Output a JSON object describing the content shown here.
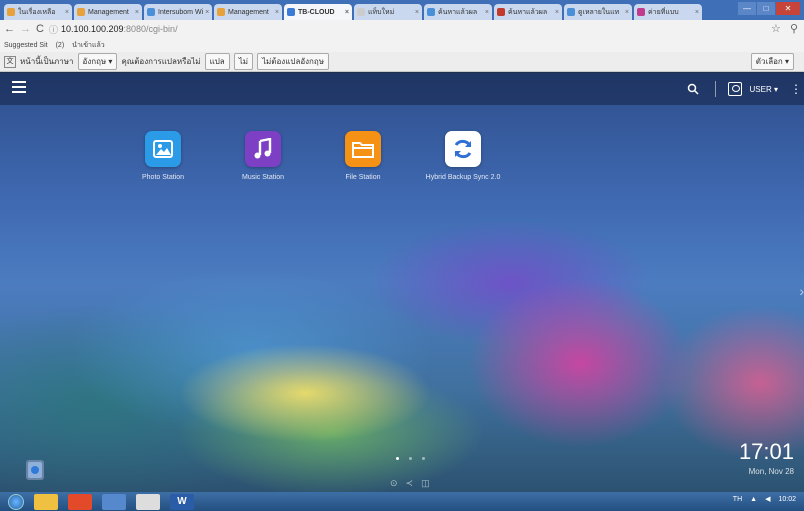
{
  "browser": {
    "tabs": [
      {
        "label": "ในเรื่องเหลือ",
        "color": "#e8a23b",
        "active": false
      },
      {
        "label": "Management",
        "color": "#e8a23b",
        "active": false
      },
      {
        "label": "Intersubom Wi",
        "color": "#4a90d9",
        "active": false
      },
      {
        "label": "Management",
        "color": "#e8a23b",
        "active": false
      },
      {
        "label": "TB-CLOUD",
        "color": "#3a7bd5",
        "active": true
      },
      {
        "label": "แท็บใหม่",
        "color": "#cccccc",
        "active": false
      },
      {
        "label": "ค้นหาแล้วผล",
        "color": "#4a90d9",
        "active": false
      },
      {
        "label": "ค้นหาแล้วผล",
        "color": "#c23a2c",
        "active": false
      },
      {
        "label": "ดูเหลายในแท",
        "color": "#4a90d9",
        "active": false
      },
      {
        "label": "ค่ายที่แบบ",
        "color": "#c23a8c",
        "active": false
      }
    ],
    "window_controls": [
      "—",
      "□",
      "✕"
    ],
    "url_main": "10.100.100.209",
    "url_rest": ":8080/cgi-bin/",
    "bookmarks": [
      "Suggested Sit",
      "(2)",
      "นำเข้าแล้ว"
    ],
    "translate": {
      "prompt": "หน้านี้เป็นภาษา",
      "language": "อังกฤษ ▾",
      "question": "คุณต้องการแปลหรือไม่",
      "translate_btn": "แปล",
      "no_btn": "ไม่",
      "never_btn": "ไม่ต้องแปลอังกฤษ",
      "options_btn": "ตัวเลือก ▾"
    }
  },
  "nas": {
    "user_label": "USER ▾",
    "apps": [
      {
        "label": "Photo Station",
        "color": "#2b9be8"
      },
      {
        "label": "Music Station",
        "color": "#7d3fc4"
      },
      {
        "label": "File Station",
        "color": "#f59114"
      },
      {
        "label": "Hybrid Backup Sync 2.0",
        "color": "#ffffff"
      }
    ],
    "clock_time": "17:01",
    "clock_date": "Mon, Nov 28"
  },
  "taskbar": {
    "apps": [
      {
        "label": "",
        "color": "#f0c040",
        "icon": "folder-icon"
      },
      {
        "label": "",
        "color": "#e24a2a",
        "icon": "chrome-icon"
      },
      {
        "label": "",
        "color": "#5588cc",
        "icon": "firefox-icon"
      },
      {
        "label": "",
        "color": "#dddddd",
        "icon": "window-icon"
      },
      {
        "label": "W",
        "color": "#2b5ca8",
        "icon": "word-icon"
      }
    ],
    "tray_lang": "TH",
    "tray_time": "10:02"
  }
}
